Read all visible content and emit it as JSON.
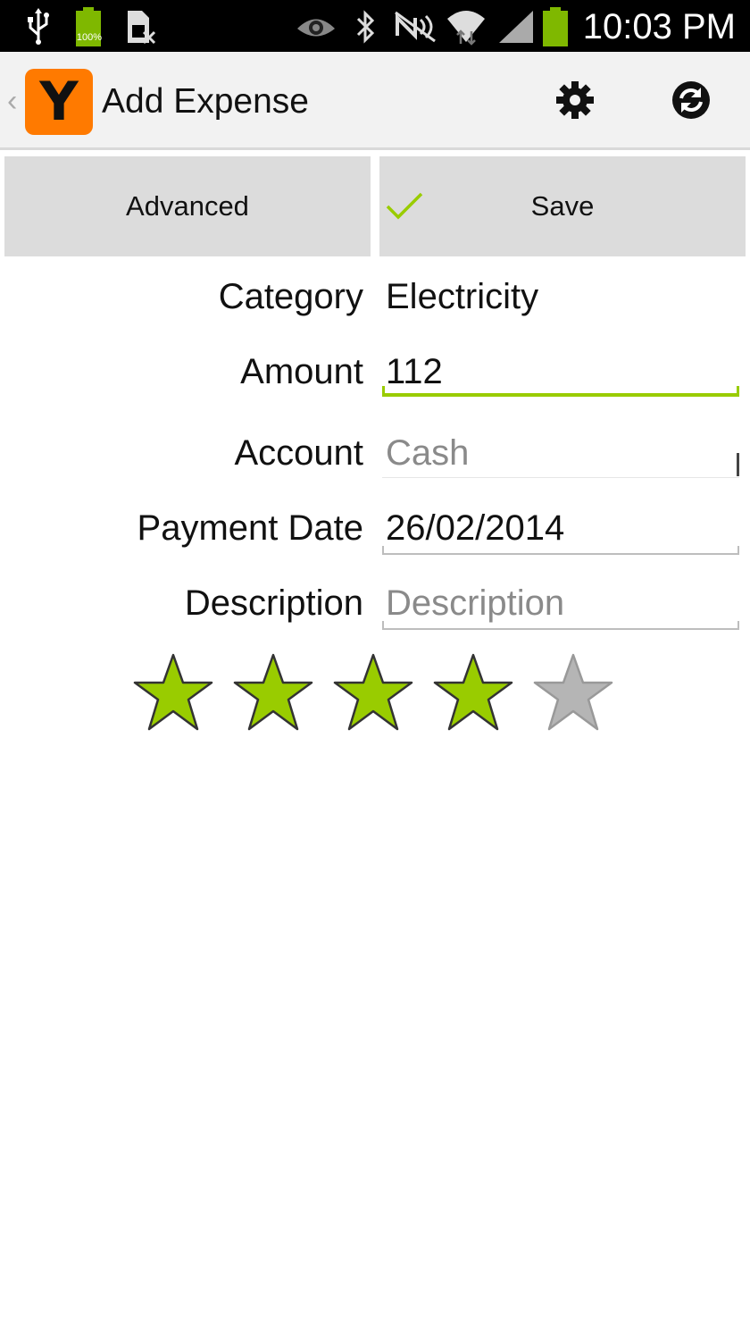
{
  "status_bar": {
    "time": "10:03 PM",
    "battery_small_label": "100%",
    "icons": [
      "usb-icon",
      "battery-full-icon",
      "sim-off-icon",
      "eye-icon",
      "bluetooth-icon",
      "nfc-mute-icon",
      "wifi-icon",
      "signal-icon",
      "battery-icon"
    ]
  },
  "action_bar": {
    "logo_letter": "Y",
    "title": "Add Expense",
    "settings_icon": "gear-icon",
    "sync_icon": "sync-icon"
  },
  "buttons": {
    "advanced_label": "Advanced",
    "save_label": "Save"
  },
  "form": {
    "category": {
      "label": "Category",
      "value": "Electricity"
    },
    "amount": {
      "label": "Amount",
      "value": "112"
    },
    "account": {
      "label": "Account",
      "value": "Cash"
    },
    "payment_date": {
      "label": "Payment Date",
      "value": "26/02/2014"
    },
    "description": {
      "label": "Description",
      "placeholder": "Description"
    }
  },
  "rating": {
    "value": 4,
    "max": 5
  },
  "colors": {
    "accent": "#99cc00",
    "logo_orange": "#ff7a00",
    "button_bg": "#dcdcdc",
    "star_empty": "#b5b5b5"
  }
}
